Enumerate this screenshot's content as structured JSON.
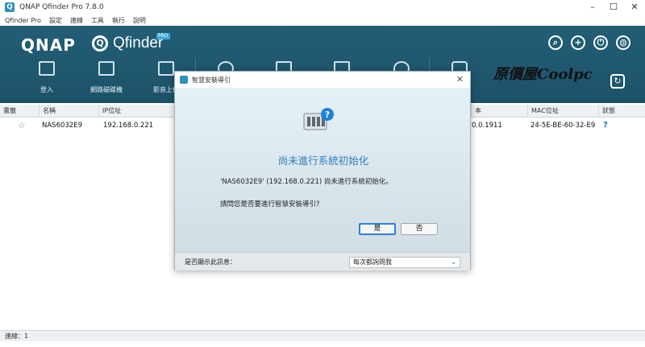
{
  "window": {
    "title": "QNAP Qfinder Pro 7.8.0",
    "controls": {
      "minimize": "–",
      "maximize": "☐",
      "close": "✕"
    }
  },
  "menu": [
    "Qfinder Pro",
    "設定",
    "連線",
    "工具",
    "執行",
    "說明"
  ],
  "header": {
    "logo": "QNAP",
    "product": "Qfinder",
    "badge": "PRO",
    "watermark": "原價屋Coolpc",
    "tools": [
      {
        "label": "登入",
        "icon": "login-icon"
      },
      {
        "label": "網路磁碟機",
        "icon": "folder-icon"
      },
      {
        "label": "影音上傳",
        "icon": "upload-icon"
      }
    ],
    "icons": [
      "search-icon",
      "add-icon",
      "power-icon",
      "globe-icon"
    ]
  },
  "table": {
    "headers": [
      "書籤",
      "名稱",
      "IP位址",
      "本",
      "MAC位址",
      "狀態"
    ],
    "rows": [
      {
        "name": "NAS6032E9",
        "ip": "192.168.0.221",
        "version": "0.0.1911",
        "mac": "24-5E-BE-60-32-E9",
        "status": "?"
      }
    ]
  },
  "status": {
    "connections": "連線：1"
  },
  "dialog": {
    "title": "智慧安裝導引",
    "heading": "尚未進行系統初始化",
    "message": "'NAS6032E9' (192.168.0.221) 尚未進行系統初始化。",
    "question": "請問您是否要進行智慧安裝導引?",
    "yes": "是",
    "no": "否",
    "footer_label": "是否顯示此訊息：",
    "footer_select": "每次都詢問我"
  },
  "colors": {
    "header": "#225e76",
    "accent": "#2f7fbf"
  }
}
